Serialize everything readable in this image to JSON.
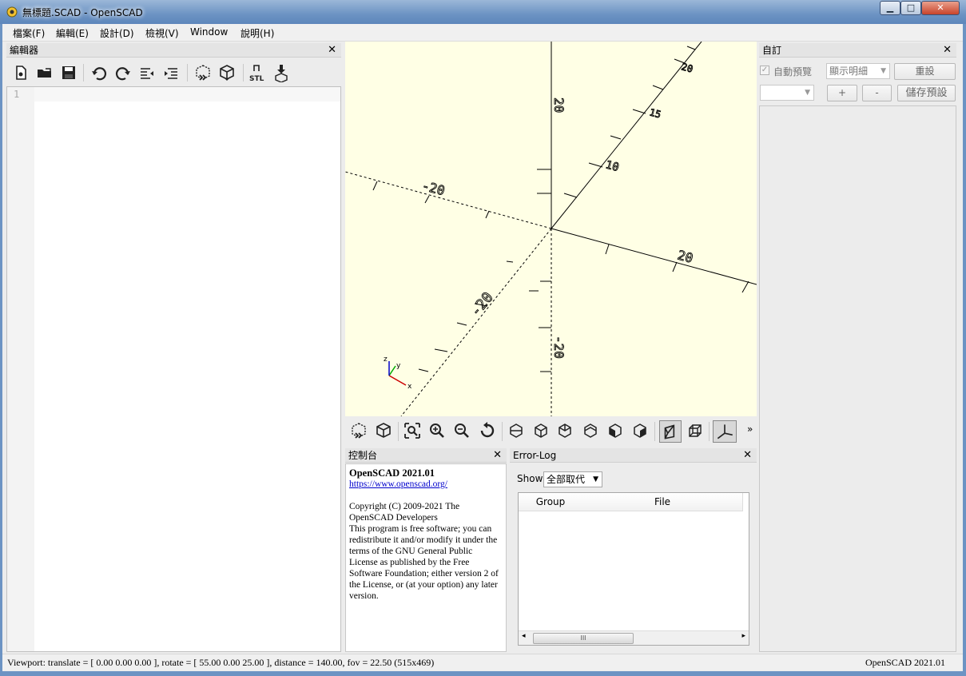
{
  "window": {
    "title": "無標題.SCAD - OpenSCAD",
    "minimize": "▁",
    "maximize": "□",
    "close": "✕"
  },
  "menu": [
    "檔案(F)",
    "編輯(E)",
    "設計(D)",
    "檢視(V)",
    "Window",
    "說明(H)"
  ],
  "editor": {
    "title": "編輯器",
    "close": "✕",
    "line_number": "1",
    "toolbar": [
      {
        "name": "new-file-icon"
      },
      {
        "name": "open-file-icon"
      },
      {
        "name": "save-icon"
      },
      {
        "name": "undo-icon"
      },
      {
        "name": "redo-icon"
      },
      {
        "name": "unindent-icon"
      },
      {
        "name": "indent-icon"
      },
      {
        "name": "preview-icon"
      },
      {
        "name": "render-icon"
      },
      {
        "name": "export-stl-icon"
      },
      {
        "name": "send-to-printer-icon"
      }
    ],
    "stl_label": "STL"
  },
  "viewport": {
    "axis_labels": {
      "z_pos": "20",
      "z_neg": "-20",
      "x_pos": "20",
      "x_neg": "-20",
      "y_pos_a": "20",
      "y_pos_b": "15",
      "y_pos_c": "10",
      "y_neg": "-20"
    },
    "gizmo": {
      "x": "x",
      "y": "y",
      "z": "z"
    }
  },
  "view_toolbar": {
    "more": "»"
  },
  "console": {
    "title": "控制台",
    "close": "✕",
    "heading": "OpenSCAD 2021.01",
    "link": "https://www.openscad.org/",
    "copyright": "Copyright (C) 2009-2021 The OpenSCAD Developers",
    "license": "This program is free software; you can redistribute it and/or modify it under the terms of the GNU General Public License as published by the Free Software Foundation; either version 2 of the License, or (at your option) any later version."
  },
  "errorlog": {
    "title": "Error-Log",
    "close": "✕",
    "show_label": "Show",
    "show_value": "全部取代",
    "columns": [
      "Group",
      "File"
    ],
    "scroll_thumb": "III"
  },
  "customizer": {
    "title": "自訂",
    "close": "✕",
    "auto_preview": "自動預覽",
    "detail_combo": "顯示明細",
    "reset": "重設",
    "preset_combo": "",
    "plus": "+",
    "minus": "-",
    "save_preset": "儲存預設"
  },
  "status": {
    "viewport": "Viewport: translate = [ 0.00 0.00 0.00 ], rotate = [ 55.00 0.00 25.00 ], distance = 140.00, fov = 22.50 (515x469)",
    "version": "OpenSCAD 2021.01"
  },
  "colors": {
    "viewport_bg": "#ffffe5",
    "title_bar": "#6c93c3",
    "axis_x": "#cc0000",
    "axis_y": "#00aa00",
    "axis_z": "#0000cc"
  }
}
